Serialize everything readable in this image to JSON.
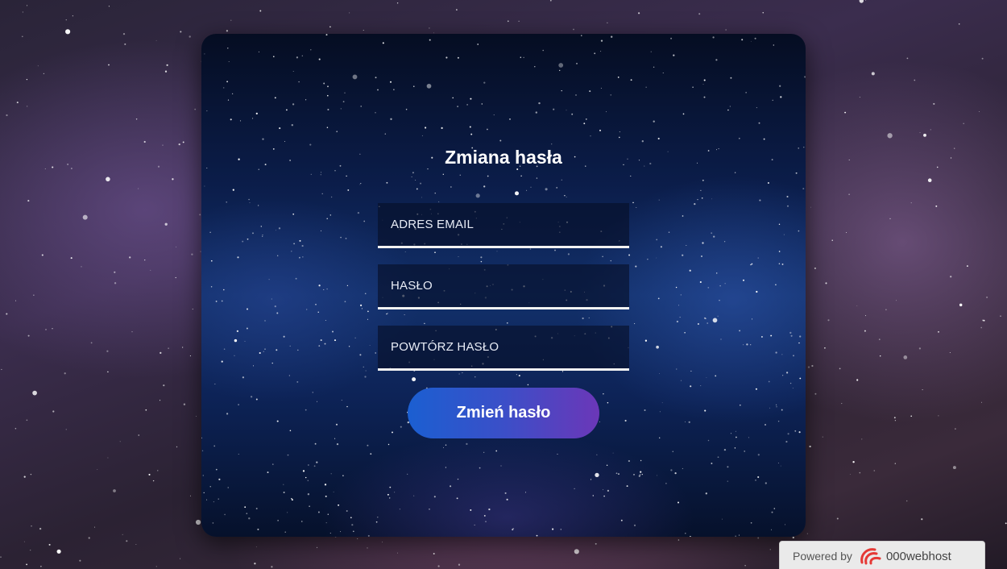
{
  "form": {
    "title": "Zmiana hasła",
    "email_placeholder": "ADRES EMAIL",
    "password_placeholder": "HASŁO",
    "repeat_password_placeholder": "POWTÓRZ HASŁO",
    "submit_label": "Zmień hasło"
  },
  "footer": {
    "powered_by": "Powered by",
    "brand": "000webhost",
    "logo_icon": "000webhost-logo-icon"
  },
  "colors": {
    "button_gradient_start": "#1b5fd1",
    "button_gradient_end": "#6b37b8",
    "field_underline": "#f2f2f2",
    "logo_red": "#e53935"
  }
}
